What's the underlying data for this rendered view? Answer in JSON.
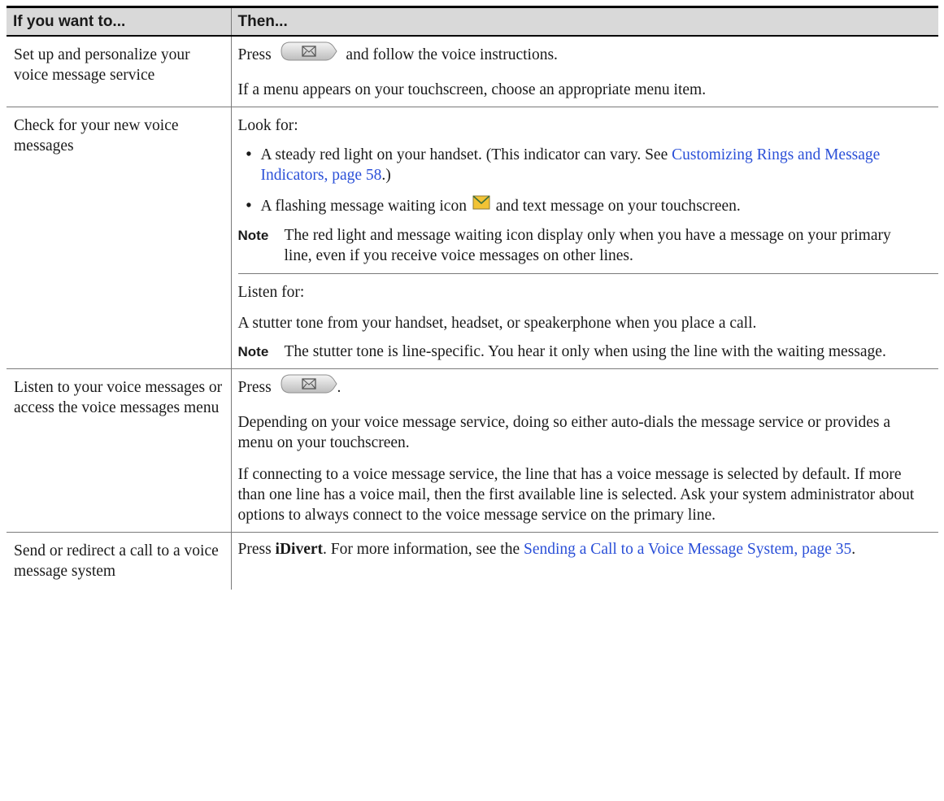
{
  "header": {
    "col1": "If you want to...",
    "col2": "Then..."
  },
  "rows": [
    {
      "task": "Set up and personalize your voice message service",
      "press_prefix": "Press",
      "press_suffix": "and follow the voice instructions.",
      "menu_text": "If a menu appears on your touchscreen, choose an appropriate menu item."
    },
    {
      "task": "Check for your new voice messages",
      "look_for": "Look for:",
      "bullet1_text": "A steady red light on your handset. (This indicator can vary. See ",
      "bullet1_link": "Customizing Rings and Message Indicators, page 58",
      "bullet1_end": ".)",
      "bullet2_prefix": "A flashing message waiting icon",
      "bullet2_suffix": "and text message on your touchscreen.",
      "note_label": "Note",
      "note1": "The red light and message waiting icon display only when you have a message on your primary line, even if you receive voice messages on other lines.",
      "listen_for": "Listen for:",
      "stutter": "A stutter tone from your handset, headset, or speakerphone when you place a call.",
      "note2": "The stutter tone is line-specific. You hear it only when using the line with the waiting message."
    },
    {
      "task": "Listen to your voice messages or access the voice messages menu",
      "press_prefix": "Press",
      "press_suffix": ".",
      "depending": "Depending on your voice message service, doing so either auto-dials the message service or provides a menu on your touchscreen.",
      "connecting": "If connecting to a voice message service, the line that has a voice message is selected by default. If more than one line has a voice mail, then the first available line is selected. Ask your system administrator about options to always connect to the voice message service on the primary line."
    },
    {
      "task": "Send or redirect a call to a voice message system",
      "press_prefix": "Press ",
      "softkey": "iDivert",
      "mid": ". For more information, see the ",
      "link": "Sending a Call to a Voice Message System, page 35",
      "end": "."
    }
  ],
  "icons": {
    "messages_button": "envelope-key-icon",
    "message_waiting": "envelope-icon"
  },
  "colors": {
    "link": "#2b50d8",
    "header_bg": "#d9d9d9",
    "envelope": "#f2c335"
  }
}
